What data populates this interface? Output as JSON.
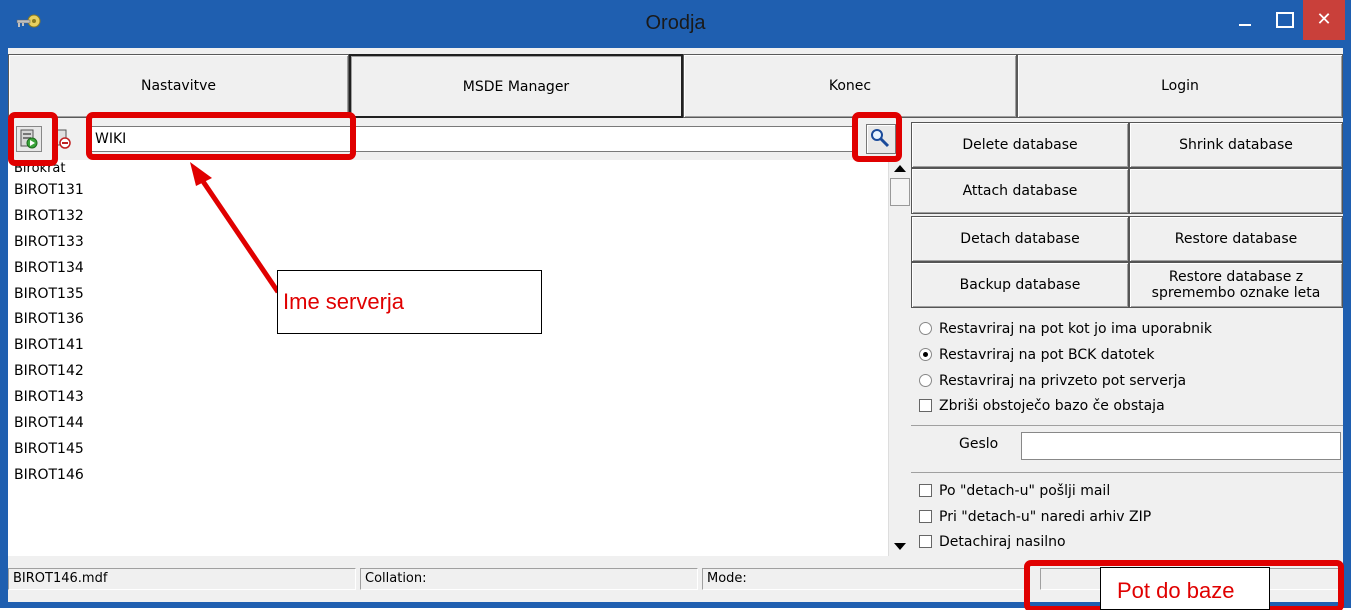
{
  "window": {
    "title": "Orodja",
    "close_glyph": "✕",
    "icon": "key-icon"
  },
  "menu": {
    "items": [
      "Nastavitve",
      "MSDE Manager",
      "Konec",
      "Login"
    ]
  },
  "toolbar": {
    "server_input_value": "WIKI"
  },
  "databases": [
    "Birokrat",
    "BIROT131",
    "BIROT132",
    "BIROT133",
    "BIROT134",
    "BIROT135",
    "BIROT136",
    "BIROT141",
    "BIROT142",
    "BIROT143",
    "BIROT144",
    "BIROT145",
    "BIROT146"
  ],
  "actions": {
    "delete": "Delete database",
    "shrink": "Shrink database",
    "attach": "Attach database",
    "detach": "Detach database",
    "restore": "Restore database",
    "backup": "Backup database",
    "restore_year": "Restore database z spremembo oznake leta"
  },
  "restore_options": [
    {
      "label": "Restavriraj na pot kot jo ima uporabnik",
      "selected": false
    },
    {
      "label": "Restavriraj na pot BCK datotek",
      "selected": true
    },
    {
      "label": "Restavriraj na privzeto pot serverja",
      "selected": false
    }
  ],
  "drop_existing": "Zbriši obstoječo bazo če obstaja",
  "password": {
    "label": "Geslo",
    "value": ""
  },
  "detach_options": [
    "Po \"detach-u\" pošlji mail",
    "Pri \"detach-u\" naredi arhiv ZIP",
    "Detachiraj nasilno"
  ],
  "status": {
    "file": "BIROT146.mdf",
    "collation": "Collation:",
    "mode": "Mode:"
  },
  "annotations": {
    "server_name": "Ime serverja",
    "db_path": "Pot do baze"
  },
  "colors": {
    "title_bar": "#1f5fb0",
    "close_button": "#c9403a",
    "annotation": "#e00000"
  }
}
